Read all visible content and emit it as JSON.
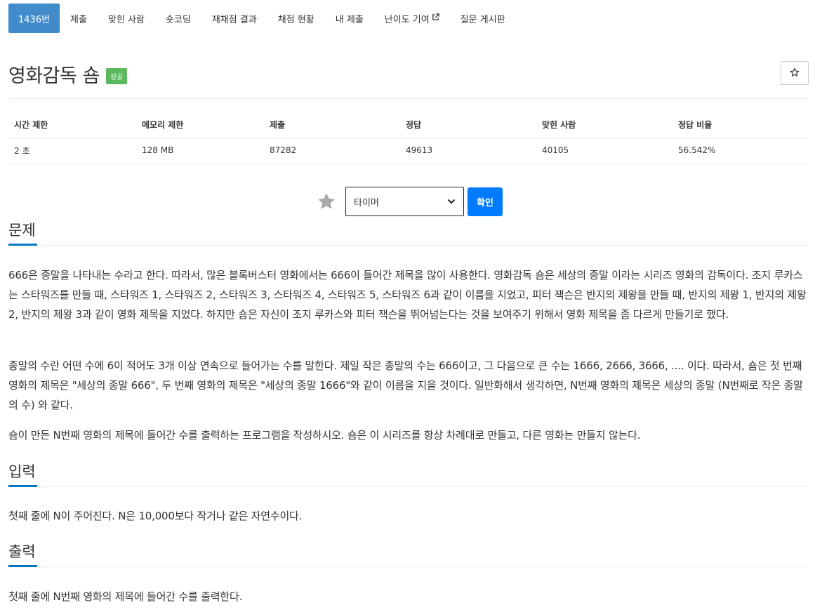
{
  "tabs": [
    {
      "label": "1436번",
      "active": true
    },
    {
      "label": "제출"
    },
    {
      "label": "맞힌 사람"
    },
    {
      "label": "숏코딩"
    },
    {
      "label": "재채점 결과"
    },
    {
      "label": "채점 현황"
    },
    {
      "label": "내 제출"
    },
    {
      "label": "난이도 기여",
      "external": true
    },
    {
      "label": "질문 게시판"
    }
  ],
  "problem": {
    "title": "영화감독 숌",
    "status_badge": "성공",
    "star_icon": "star-outline-icon"
  },
  "info_table": {
    "headers": [
      "시간 제한",
      "메모리 제한",
      "제출",
      "정답",
      "맞힌 사람",
      "정답 비율"
    ],
    "values": [
      "2 초",
      "128 MB",
      "87282",
      "49613",
      "40105",
      "56.542%"
    ]
  },
  "timer": {
    "selected": "타이머",
    "confirm_label": "확인"
  },
  "sections": {
    "problem_label": "문제",
    "problem_paragraphs": [
      "666은 종말을 나타내는 수라고 한다. 따라서, 많은 블록버스터 영화에서는 666이 들어간 제목을 많이 사용한다. 영화감독 숌은 세상의 종말 이라는 시리즈 영화의 감독이다. 조지 루카스는 스타워즈를 만들 때, 스타워즈 1, 스타워즈 2, 스타워즈 3, 스타워즈 4, 스타워즈 5, 스타워즈 6과 같이 이름을 지었고, 피터 잭슨은 반지의 제왕을 만들 때, 반지의 제왕 1, 반지의 제왕 2, 반지의 제왕 3과 같이 영화 제목을 지었다. 하지만 숌은 자신이 조지 루카스와 피터 잭슨을 뛰어넘는다는 것을 보여주기 위해서 영화 제목을 좀 다르게 만들기로 했다.",
      "종말의 수란 어떤 수에 6이 적어도 3개 이상 연속으로 들어가는 수를 말한다. 제일 작은 종말의 수는 666이고, 그 다음으로 큰 수는 1666, 2666, 3666, .... 이다. 따라서, 숌은 첫 번째 영화의 제목은 \"세상의 종말 666\", 두 번째 영화의 제목은 \"세상의 종말 1666\"와 같이 이름을 지을 것이다. 일반화해서 생각하면, N번째 영화의 제목은 세상의 종말 (N번째로 작은 종말의 수) 와 같다.",
      "숌이 만든 N번째 영화의 제목에 들어간 수를 출력하는 프로그램을 작성하시오. 숌은 이 시리즈를 항상 차례대로 만들고, 다른 영화는 만들지 않는다."
    ],
    "input_label": "입력",
    "input_text": "첫째 줄에 N이 주어진다. N은 10,000보다 작거나 같은 자연수이다.",
    "output_label": "출력",
    "output_text": "첫째 줄에 N번째 영화의 제목에 들어간 수를 출력한다."
  },
  "colors": {
    "tab_active": "#428bca",
    "badge_success": "#5cb85c",
    "confirm_button": "#007bff",
    "section_underline": "#0076c0"
  }
}
